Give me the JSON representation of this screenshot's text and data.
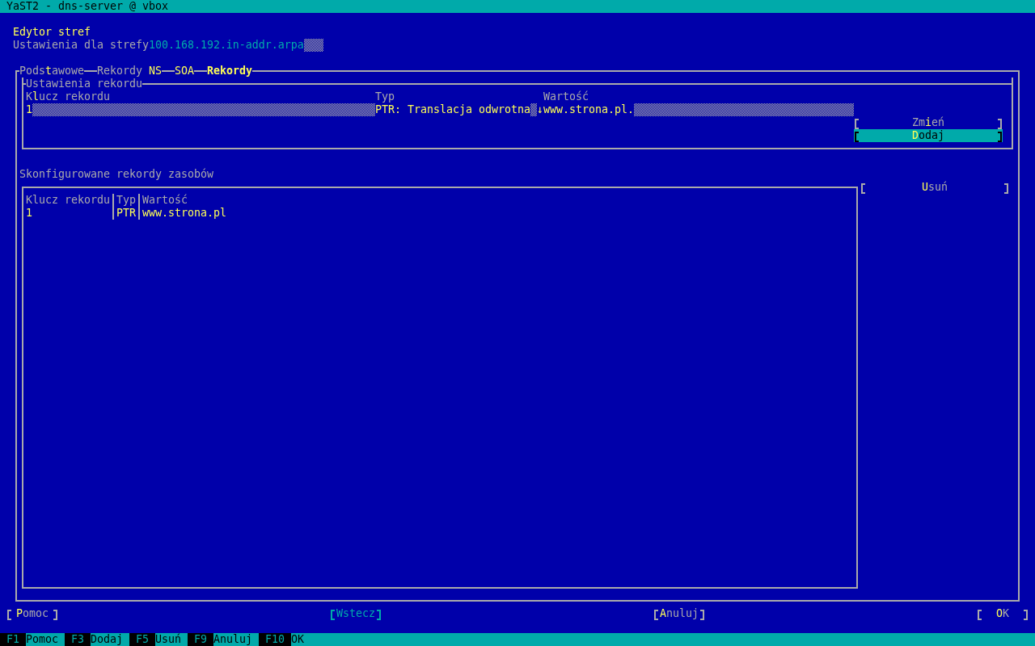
{
  "window": {
    "title": "YaST2 - dns-server @ vbox"
  },
  "header": {
    "title": "Edytor stref",
    "zone_label": "Ustawienia dla strefy",
    "zone_value": "100.168.192.in-addr.arpa"
  },
  "tabs": [
    {
      "label": "Pods**t**awowe",
      "selected": false,
      "highlighted": false
    },
    {
      "label": "Rekordy **NS**",
      "selected": false,
      "highlighted": false
    },
    {
      "label": "SOA",
      "selected": false,
      "highlighted": true
    },
    {
      "label": "Rekordy",
      "selected": true,
      "highlighted": false
    }
  ],
  "record_settings": {
    "title": "Ustawienia rekordu",
    "fields": [
      {
        "kind": "input",
        "label": "K**l**ucz rekordu",
        "value": "1"
      },
      {
        "kind": "combo",
        "label": "Typ",
        "value": "PTR: Translacja odwrotna",
        "arrow": "↓"
      },
      {
        "kind": "input",
        "label": "Wartość",
        "value": "www.strona.pl."
      }
    ],
    "buttons": [
      {
        "label": "Zm**i**eń",
        "focused": false
      },
      {
        "label": "**D**odaj",
        "focused": true
      }
    ]
  },
  "records": {
    "title": "Skonfigurowane rekordy zasobów",
    "columns": [
      "Klucz rekordu",
      "Typ",
      "Wartość"
    ],
    "rows": [
      {
        "cells": [
          "1",
          "PTR",
          "www.strona.pl"
        ],
        "selected": true
      }
    ],
    "buttons": [
      {
        "label": "**U**suń",
        "focused": false
      }
    ]
  },
  "footer_buttons": [
    {
      "label": "**P**omoc",
      "disabled": false
    },
    {
      "label": "Wstecz",
      "disabled": true
    },
    {
      "label": "**A**nuluj",
      "disabled": false
    },
    {
      "label": "**O**K",
      "disabled": false
    }
  ],
  "function_keys": [
    {
      "key": "F1",
      "label": "Pomoc"
    },
    {
      "key": "F3",
      "label": "Dodaj"
    },
    {
      "key": "F5",
      "label": "Usuń"
    },
    {
      "key": "F9",
      "label": "Anuluj"
    },
    {
      "key": "F10",
      "label": "OK"
    }
  ]
}
